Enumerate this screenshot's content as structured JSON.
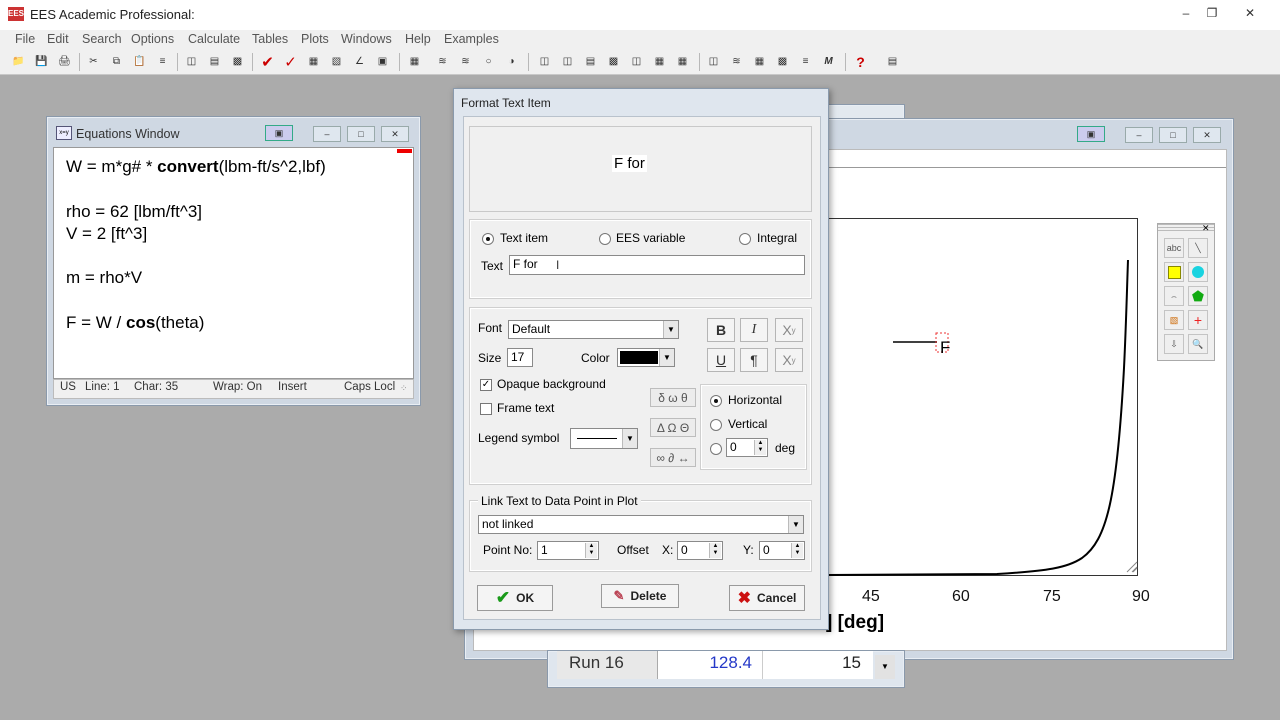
{
  "app": {
    "title": "EES Academic Professional:",
    "icon_label": "EES"
  },
  "menu": [
    "File",
    "Edit",
    "Search",
    "Options",
    "Calculate",
    "Tables",
    "Plots",
    "Windows",
    "Help",
    "Examples"
  ],
  "equations_window": {
    "title": "Equations Window",
    "lines": [
      [
        {
          "t": "W = m*g# * "
        },
        {
          "t": "convert",
          "b": true
        },
        {
          "t": "(lbm-ft/s^2,lbf)"
        }
      ],
      [],
      [
        {
          "t": "rho = 62 [lbm/ft^3]"
        }
      ],
      [
        {
          "t": "V = 2 [ft^3]"
        }
      ],
      [],
      [
        {
          "t": "m = rho*V"
        }
      ],
      [],
      [
        {
          "t": "F = W / "
        },
        {
          "t": "cos",
          "b": true
        },
        {
          "t": "(theta)"
        }
      ]
    ],
    "status": {
      "lang": "US",
      "line": "Line: 1",
      "char": "Char: 35",
      "wrap": "Wrap: On",
      "mode": "Insert",
      "caps": "Caps Locl"
    }
  },
  "dialog": {
    "title": "Format Text Item",
    "preview_text": "F for",
    "item_types": {
      "text_item": "Text item",
      "ees_variable": "EES variable",
      "integral": "Integral",
      "selected": "Text item"
    },
    "text_label": "Text",
    "text_value": "F for",
    "font_label": "Font",
    "font_value": "Default",
    "size_label": "Size",
    "size_value": "17",
    "color_label": "Color",
    "color_value": "#000000",
    "style_buttons": {
      "bold": "B",
      "italic": "I",
      "subscript": "X",
      "underline": "U",
      "paragraph": "¶",
      "superscript": "X"
    },
    "opaque_label": "Opaque background",
    "opaque_checked": true,
    "frame_label": "Frame text",
    "frame_checked": false,
    "legend_label": "Legend symbol",
    "symbol_buttons": [
      "δ ω θ",
      "Δ Ω Θ",
      "∞ ∂ ↔"
    ],
    "orientation": {
      "horizontal": "Horizontal",
      "vertical": "Vertical",
      "angle_value": "0",
      "deg": "deg",
      "selected": "Horizontal"
    },
    "link_group": {
      "title": "Link Text to Data Point in Plot",
      "value": "not linked",
      "point_label": "Point No:",
      "point_value": "1",
      "offset_label": "Offset",
      "x_label": "X:",
      "x_value": "0",
      "y_label": "Y:",
      "y_value": "0"
    },
    "buttons": {
      "ok": "OK",
      "delete": "Delete",
      "cancel": "Cancel"
    }
  },
  "plot_window": {
    "x_ticks": [
      "45",
      "60",
      "75",
      "90"
    ],
    "x_label_fragment": "] [deg]",
    "text_item": "F",
    "table_row": {
      "label": "Run 16",
      "v1": "128.4",
      "v2": "15"
    }
  }
}
